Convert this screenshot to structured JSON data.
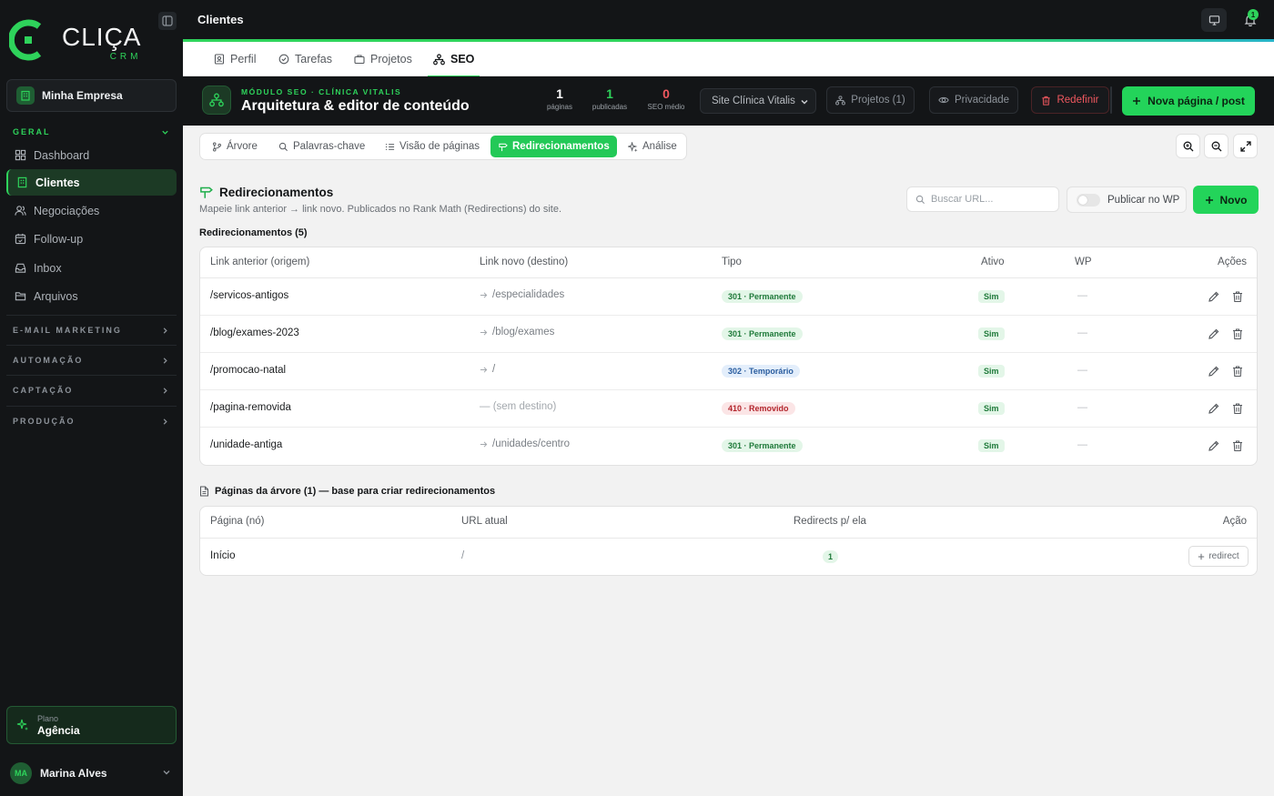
{
  "brand": {
    "name": "CLIÇA",
    "sub": "CRM"
  },
  "colors": {
    "accent": "#2ed35b",
    "sidebar_bg": "#131517",
    "danger": "#f0585f",
    "info": "#2a5d9f"
  },
  "sidebar": {
    "company": "Minha Empresa",
    "section_geral": "GERAL",
    "items": [
      {
        "label": "Dashboard",
        "icon": "grid-icon"
      },
      {
        "label": "Clientes",
        "icon": "building-icon",
        "active": true
      },
      {
        "label": "Negociações",
        "icon": "users-icon"
      },
      {
        "label": "Follow-up",
        "icon": "calendar-icon"
      },
      {
        "label": "Inbox",
        "icon": "inbox-icon"
      },
      {
        "label": "Arquivos",
        "icon": "folder-icon"
      }
    ],
    "sections": [
      "E-MAIL MARKETING",
      "AUTOMAÇÃO",
      "CAPTAÇÃO",
      "PRODUÇÃO"
    ],
    "plan_label": "Plano",
    "plan_value": "Agência",
    "user_initials": "MA",
    "user_name": "Marina Alves"
  },
  "topbar": {
    "title": "Clientes",
    "notifications": "1"
  },
  "main_tabs": [
    {
      "label": "Perfil",
      "icon": "badge-icon"
    },
    {
      "label": "Tarefas",
      "icon": "check-circle-icon"
    },
    {
      "label": "Projetos",
      "icon": "briefcase-icon"
    },
    {
      "label": "SEO",
      "icon": "sitemap-icon",
      "active": true
    }
  ],
  "seo": {
    "module": "MÓDULO SEO · CLÍNICA VITALIS",
    "title": "Arquitetura & editor de conteúdo",
    "stats": [
      {
        "num": "1",
        "label": "páginas",
        "color": "#ffffff"
      },
      {
        "num": "1",
        "label": "publicadas",
        "color": "#2ed35b"
      },
      {
        "num": "0",
        "label": "SEO médio",
        "color": "#f0585f"
      }
    ],
    "site": "Site Clínica Vitalis",
    "projects_btn": "Projetos (1)",
    "privacy_btn": "Privacidade",
    "reset_btn": "Redefinir",
    "new_page_btn": "Nova página / post"
  },
  "sub_tabs": [
    {
      "label": "Árvore",
      "icon": "branch-icon"
    },
    {
      "label": "Palavras-chave",
      "icon": "search-icon"
    },
    {
      "label": "Visão de páginas",
      "icon": "list-icon"
    },
    {
      "label": "Redirecionamentos",
      "icon": "signpost-icon",
      "active": true
    },
    {
      "label": "Análise",
      "icon": "sparkle-icon"
    }
  ],
  "redirects": {
    "title": "Redirecionamentos",
    "description": "Mapeie link anterior → link novo. Publicados no Rank Math (Redirections) do site.",
    "search_placeholder": "Buscar URL...",
    "publish_label": "Publicar no WP",
    "new_btn": "Novo",
    "count_label": "Redirecionamentos (5)",
    "columns": [
      "Link anterior (origem)",
      "Link novo (destino)",
      "Tipo",
      "Ativo",
      "WP",
      "Ações"
    ],
    "rows": [
      {
        "origin": "/servicos-antigos",
        "dest": "/especialidades",
        "has_dest": true,
        "type": "301 · Permanente",
        "kind": "301",
        "active": "Sim",
        "wp": "—"
      },
      {
        "origin": "/blog/exames-2023",
        "dest": "/blog/exames",
        "has_dest": true,
        "type": "301 · Permanente",
        "kind": "301",
        "active": "Sim",
        "wp": "—"
      },
      {
        "origin": "/promocao-natal",
        "dest": "/",
        "has_dest": true,
        "type": "302 · Temporário",
        "kind": "302",
        "active": "Sim",
        "wp": "—"
      },
      {
        "origin": "/pagina-removida",
        "dest": "— (sem destino)",
        "has_dest": false,
        "type": "410 · Removido",
        "kind": "410",
        "active": "Sim",
        "wp": "—"
      },
      {
        "origin": "/unidade-antiga",
        "dest": "/unidades/centro",
        "has_dest": true,
        "type": "301 · Permanente",
        "kind": "301",
        "active": "Sim",
        "wp": "—"
      }
    ]
  },
  "pages": {
    "title": "Páginas da árvore (1) — base para criar redirecionamentos",
    "columns": [
      "Página (nó)",
      "URL atual",
      "Redirects p/ ela",
      "Ação"
    ],
    "rows": [
      {
        "page": "Início",
        "url": "/",
        "redirects": "1",
        "action": "redirect"
      }
    ]
  }
}
